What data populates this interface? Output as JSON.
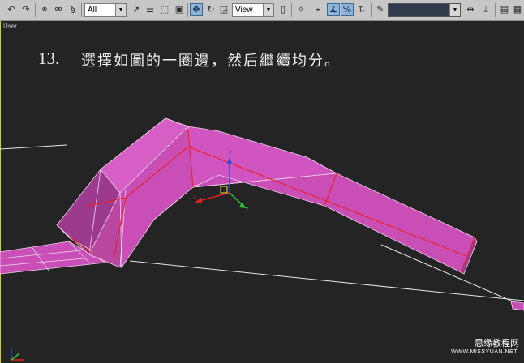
{
  "toolbar": {
    "selection_filter": "All",
    "reference_coordinate": "View",
    "named_selection": ""
  },
  "viewport": {
    "label": "User"
  },
  "caption": {
    "number": "13.",
    "text": "選擇如圖的一圈邊，然后繼續均分。"
  },
  "watermark": {
    "site_name": "思缘教程网",
    "url": "WWW.MISSYUAN.NET"
  },
  "colors": {
    "toolbar_bg": "#c7c7c7",
    "viewport_bg": "#242424",
    "mesh_face": "#c94fb6",
    "mesh_face_dark": "#9c3a8e",
    "mesh_edge": "#f4d4ef",
    "selected_edge": "#e8202a",
    "gizmo_x": "#e62020",
    "gizmo_y": "#2fc53a",
    "gizmo_z": "#2a4bd8"
  },
  "icons": {
    "undo": "undo-icon",
    "redo": "redo-icon",
    "select": "select-arrow-icon",
    "move": "move-icon",
    "rotate": "rotate-icon",
    "scale": "scale-icon"
  }
}
